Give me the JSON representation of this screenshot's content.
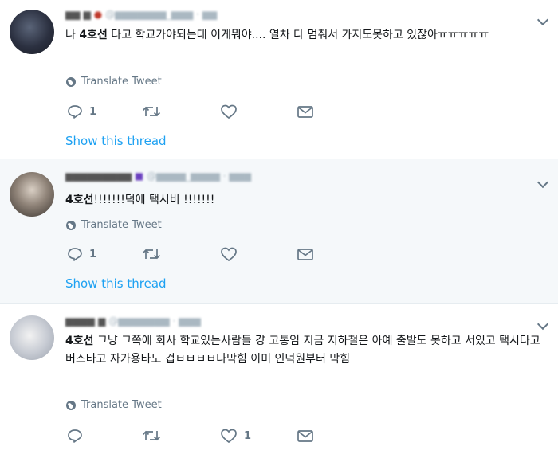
{
  "tweets": [
    {
      "text_bold": "4호선",
      "text_prefix": "나 ",
      "text_rest": " 타고 학교가야되는데 이게뭐야.... 열차 다 멈춰서 가지도못하고 있잖아ㅠㅠㅠㅠㅠ",
      "translate": "Translate Tweet",
      "reply_count": "1",
      "retweet_count": "",
      "like_count": "",
      "show_thread": "Show this thread"
    },
    {
      "text_bold": "4호선",
      "text_prefix": "",
      "text_rest": "!!!!!!!덕에 택시비 !!!!!!!",
      "translate": "Translate Tweet",
      "reply_count": "1",
      "retweet_count": "",
      "like_count": "",
      "show_thread": "Show this thread"
    },
    {
      "text_bold": "4호선",
      "text_prefix": "",
      "text_rest": " 그냥 그쪽에 회사 학교있는사람들 걍 고통임 지금 지하철은 아예 출발도 못하고 서있고 택시타고 버스타고 자가용타도 겁ㅂㅂㅂㅂ나막힘 이미 인덕원부터 막힘",
      "translate": "Translate Tweet",
      "reply_count": "",
      "retweet_count": "",
      "like_count": "1"
    }
  ],
  "colors": {
    "link": "#1da1f2",
    "muted": "#657786",
    "selected_bg": "#f5f8fa",
    "text": "#14171a"
  },
  "icons": [
    "reply-icon",
    "retweet-icon",
    "like-icon",
    "dm-icon",
    "globe-icon",
    "chevron-down-icon"
  ]
}
